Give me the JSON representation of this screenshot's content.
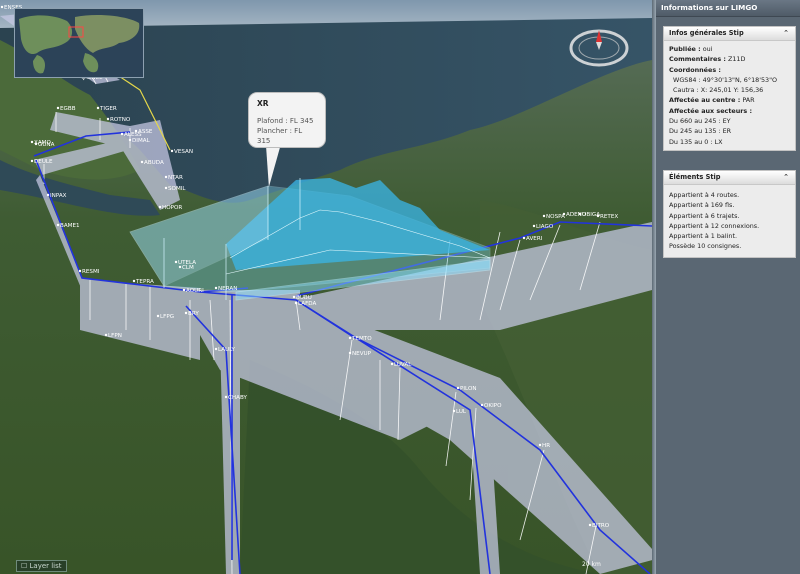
{
  "panel": {
    "title": "Informations sur LIMGO",
    "general": {
      "header": "Infos générales Stip",
      "publiee_label": "Publiée :",
      "publiee_value": "oui",
      "commentaires_label": "Commentaires :",
      "commentaires_value": "Z11D",
      "coords_label": "Coordonnées :",
      "coord_wgs": "WGS84 : 49°30'13\"N, 6°18'53\"O",
      "coord_cautra": "Cautra : X: 245,01 Y: 156,36",
      "centre_label": "Affectée au centre :",
      "centre_value": "PAR",
      "secteurs_label": "Affectée aux secteurs :",
      "secteurs": [
        "Du 660 au 245 : EY",
        "Du 245 au 135 : ER",
        "Du 135 au 0 : LX"
      ],
      "collapse_glyph": "⌃"
    },
    "elements": {
      "header": "Éléments Stip",
      "collapse_glyph": "⌃",
      "items": [
        "Appartient à 4 routes.",
        "Appartient à 169 fls.",
        "Appartient à 6 trajets.",
        "Appartient à 12 connexions.",
        "Appartient à 1 balint.",
        "Possède 10 consignes."
      ]
    }
  },
  "bubble": {
    "title": "XR",
    "plafond": "Plafond : FL 345",
    "plancher": "Plancher : FL 315"
  },
  "map": {
    "layer_button": "☐ Layer list",
    "scale": "20 km",
    "compass_icon": "compass-icon",
    "colors": {
      "route_line": "#2233dd",
      "corridor_fill": "#c8cae6",
      "sector_fill": "#3ab6e8",
      "ground": "#3a5a2c"
    },
    "waypoints": [
      {
        "name": "ENSES"
      },
      {
        "name": "LESTA"
      },
      {
        "name": "RENEL"
      },
      {
        "name": "EGBB"
      },
      {
        "name": "TIGER"
      },
      {
        "name": "ROTNO"
      },
      {
        "name": "ALESS"
      },
      {
        "name": "DIMAL"
      },
      {
        "name": "ASSE"
      },
      {
        "name": "VESAN"
      },
      {
        "name": "ABUDA"
      },
      {
        "name": "XAMO"
      },
      {
        "name": "GUNA"
      },
      {
        "name": "DEULE"
      },
      {
        "name": "NTAR"
      },
      {
        "name": "SOMIL"
      },
      {
        "name": "INPAX"
      },
      {
        "name": "HOPOR"
      },
      {
        "name": "BAME1"
      },
      {
        "name": "UTELA"
      },
      {
        "name": "CLM"
      },
      {
        "name": "RESMI"
      },
      {
        "name": "TEPRA"
      },
      {
        "name": "AOURI"
      },
      {
        "name": "NERAN"
      },
      {
        "name": "BUBU"
      },
      {
        "name": "LAFDA"
      },
      {
        "name": "LFPG"
      },
      {
        "name": "BRY"
      },
      {
        "name": "LFPN"
      },
      {
        "name": "LAULY"
      },
      {
        "name": "TEMTO"
      },
      {
        "name": "NEVUP"
      },
      {
        "name": "LUVAL"
      },
      {
        "name": "CHABY"
      },
      {
        "name": "PILON"
      },
      {
        "name": "OKIPO"
      },
      {
        "name": "LUL"
      },
      {
        "name": "HR"
      },
      {
        "name": "BITRO"
      },
      {
        "name": "NOSPA"
      },
      {
        "name": "ADENU"
      },
      {
        "name": "OBIGA"
      },
      {
        "name": "RETEX"
      },
      {
        "name": "LIAGO"
      },
      {
        "name": "AVERI"
      }
    ]
  }
}
